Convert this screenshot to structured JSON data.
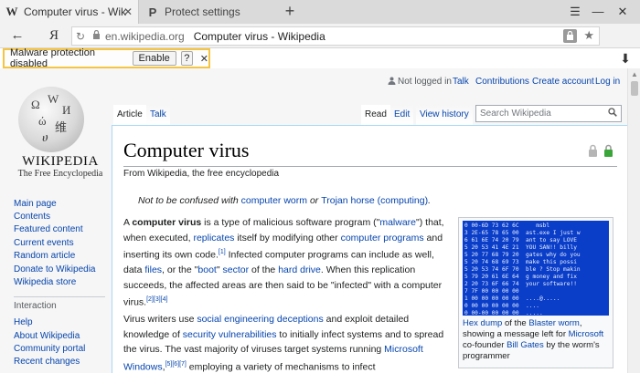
{
  "browser": {
    "tabs": [
      {
        "icon": "W",
        "title": "Computer virus - Wikipedia",
        "close": "✕"
      },
      {
        "icon": "P",
        "title": "Protect settings"
      }
    ],
    "new_tab": "+",
    "menu_icon": "☰",
    "minimize": "—",
    "close": "✕",
    "back": "←",
    "yandex": "Я",
    "reload": "↻",
    "lock": "🔒",
    "domain": "en.wikipedia.org",
    "page_title": "Computer virus - Wikipedia",
    "ext_label": "🔒",
    "bookmark": "★",
    "download": "⬇"
  },
  "malware": {
    "text": "Malware protection disabled",
    "enable": "Enable",
    "help": "?",
    "dismiss": "✕"
  },
  "wiki": {
    "logo_word": "WIKIPEDIA",
    "logo_tag": "The Free Encyclopedia",
    "sidebar": {
      "nav": [
        "Main page",
        "Contents",
        "Featured content",
        "Current events",
        "Random article",
        "Donate to Wikipedia",
        "Wikipedia store"
      ],
      "interaction_head": "Interaction",
      "interaction": [
        "Help",
        "About Wikipedia",
        "Community portal",
        "Recent changes"
      ]
    },
    "user": {
      "not_logged": "Not logged in",
      "talk": "Talk",
      "contributions": "Contributions",
      "create": "Create account",
      "login": "Log in"
    },
    "tabs": {
      "article": "Article",
      "talk": "Talk",
      "read": "Read",
      "edit": "Edit",
      "history": "View history"
    },
    "search_placeholder": "Search Wikipedia",
    "title": "Computer virus",
    "from": "From Wikipedia, the free encyclopedia",
    "hatnote": {
      "prefix": "Not to be confused with",
      "link1": "computer worm",
      "mid": "or",
      "link2": "Trojan horse (computing)",
      "end": "."
    },
    "para1": {
      "t1": "A ",
      "b1": "computer virus",
      "t2": " is a type of malicious software program (\"",
      "l1": "malware",
      "t3": "\") that, when executed, ",
      "l2": "replicates",
      "t4": " itself by modifying other ",
      "l3": "computer programs",
      "t5": " and inserting its own code.",
      "s1": "[1]",
      "t6": " Infected computer programs can include as well, data ",
      "l4": "files",
      "t7": ", or the \"",
      "l5": "boot",
      "t8": "\" ",
      "l6": "sector",
      "t9": " of the ",
      "l7": "hard drive",
      "t10": ". When this replication succeeds, the affected areas are then said to be \"infected\" with a computer virus.",
      "s2": "[2][3][4]"
    },
    "para2": {
      "t1": "Virus writers use ",
      "l1": "social engineering",
      "t2": " ",
      "l2": "deceptions",
      "t3": " and exploit detailed knowledge of ",
      "l3": "security vulnerabilities",
      "t4": " to initially infect systems and to spread the virus. The vast majority of viruses target systems running ",
      "l4": "Microsoft Windows",
      "t5": ",",
      "s1": "[5][6][7]",
      "t6": " employing a variety of mechanisms to infect"
    },
    "hexdump": "0 00-6D 73 62 6C     msbl\n3 2E-65 78 65 00  ast.exe I just w\n6 61 6E 74 20 79  ant to say LOVE\n5 20 53 41 4E 21  YOU SAN!! billy\n5 20 77 68 79 20  gates why do you\n5 20 74 68 69 73  make this possi\n5 20 53 74 6F 70  ble ? Stop makin\n5 79 20 61 6E 64  g money and fix\n2 20 73 6F 66 74  your software!!\n7 7F 00 00 00 00\n1 00 00 00 00 00  ....@.....\n0 00 00 00 00 00  ....\n0 00-00 00 00 00  .....\n0 00-00 00 00 00  ......\n0 00-01 00 01 00  .........\n6 61-00 00 00 00  ..ça..",
    "caption": {
      "l1": "Hex dump",
      "t1": " of the ",
      "l2": "Blaster worm",
      "t2": ", showing a message left for ",
      "l3": "Microsoft",
      "t3": " co-founder ",
      "l4": "Bill Gates",
      "t4": " by the worm's programmer"
    }
  }
}
